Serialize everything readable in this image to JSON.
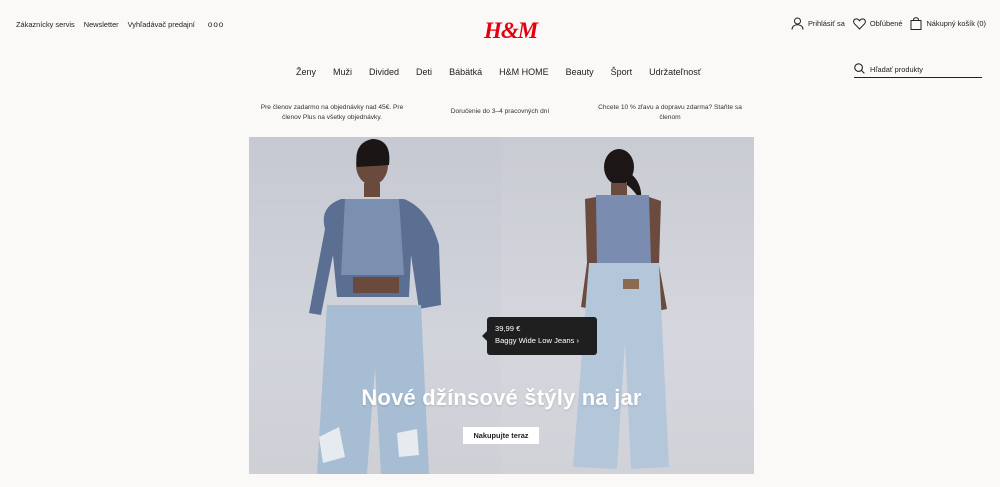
{
  "topbar": {
    "links": [
      "Zákaznícky servis",
      "Newsletter",
      "Vyhľadávač predajní"
    ],
    "more": "ooo"
  },
  "logo": "H&M",
  "account": {
    "login": "Prihlásiť sa",
    "favorites": "Obľúbené",
    "cart": "Nákupný košík (0)"
  },
  "nav": {
    "items": [
      "Ženy",
      "Muži",
      "Divided",
      "Deti",
      "Bábätká",
      "H&M HOME",
      "Beauty",
      "Šport",
      "Udržateľnosť"
    ]
  },
  "search": {
    "placeholder": "Hľadať produkty"
  },
  "promos": [
    "Pre členov zadarmo na objednávky nad 45€. Pre členov Plus na všetky objednávky.",
    "Doručenie do 3–4 pracovných dní",
    "Chcete 10 % zľavu a dopravu zdarma? Staňte sa členom"
  ],
  "hero": {
    "price": "39,99 €",
    "product": "Baggy Wide Low Jeans",
    "product_arrow": "›",
    "headline": "Nové džínsové štýly na jar",
    "cta": "Nakupujte teraz"
  },
  "colors": {
    "brand": "#e50010",
    "background": "#faf9f8",
    "text": "#222222"
  }
}
